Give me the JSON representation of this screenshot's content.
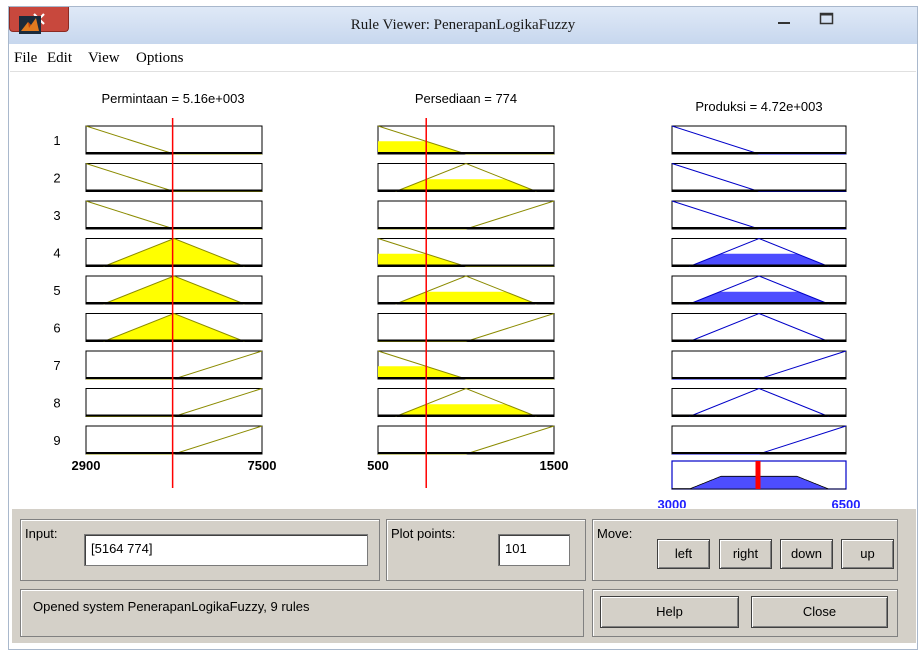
{
  "window": {
    "title": "Rule Viewer: PenerapanLogikaFuzzy",
    "controls": [
      "minimize",
      "maximize",
      "close"
    ],
    "close_color": "#c8483d"
  },
  "menu": [
    "File",
    "Edit",
    "View",
    "Options"
  ],
  "inputs": [
    {
      "header": "Permintaan = 5.16e+003",
      "range": [
        2900,
        7500
      ],
      "min_label": "2900",
      "max_label": "7500",
      "value": 5164
    },
    {
      "header": "Persediaan = 774",
      "range": [
        500,
        1500
      ],
      "min_label": "500",
      "max_label": "1500",
      "value": 774
    }
  ],
  "output": {
    "header": "Produksi = 4.72e+003",
    "range": [
      3000,
      6500
    ],
    "min_label": "3000",
    "max_label": "6500",
    "value": 4720,
    "aggregate_fill": "#4d4dff"
  },
  "rule_numbers": [
    "1",
    "2",
    "3",
    "4",
    "5",
    "6",
    "7",
    "8",
    "9"
  ],
  "rules": [
    {
      "permintaan": "low",
      "persediaan": "low",
      "produksi": "low"
    },
    {
      "permintaan": "low",
      "persediaan": "medium",
      "produksi": "low"
    },
    {
      "permintaan": "low",
      "persediaan": "high",
      "produksi": "low"
    },
    {
      "permintaan": "medium",
      "persediaan": "low",
      "produksi": "medium"
    },
    {
      "permintaan": "medium",
      "persediaan": "medium",
      "produksi": "medium"
    },
    {
      "permintaan": "medium",
      "persediaan": "high",
      "produksi": "medium"
    },
    {
      "permintaan": "high",
      "persediaan": "low",
      "produksi": "high"
    },
    {
      "permintaan": "high",
      "persediaan": "medium",
      "produksi": "medium"
    },
    {
      "permintaan": "high",
      "persediaan": "high",
      "produksi": "high"
    }
  ],
  "colors": {
    "input_line": "#8b8b00",
    "input_fill": "#ffff00",
    "output_line": "#0000c8",
    "output_fill": "#4d4dff",
    "index_line": "#ff0000",
    "axis_label_output": "#2020ff"
  },
  "controls": {
    "input_label": "Input:",
    "input_value": "[5164 774]",
    "plot_points_label": "Plot points:",
    "plot_points_value": "101",
    "move_label": "Move:",
    "move_buttons": [
      "left",
      "right",
      "down",
      "up"
    ],
    "help_label": "Help",
    "close_label": "Close",
    "status": "Opened system PenerapanLogikaFuzzy, 9 rules"
  }
}
